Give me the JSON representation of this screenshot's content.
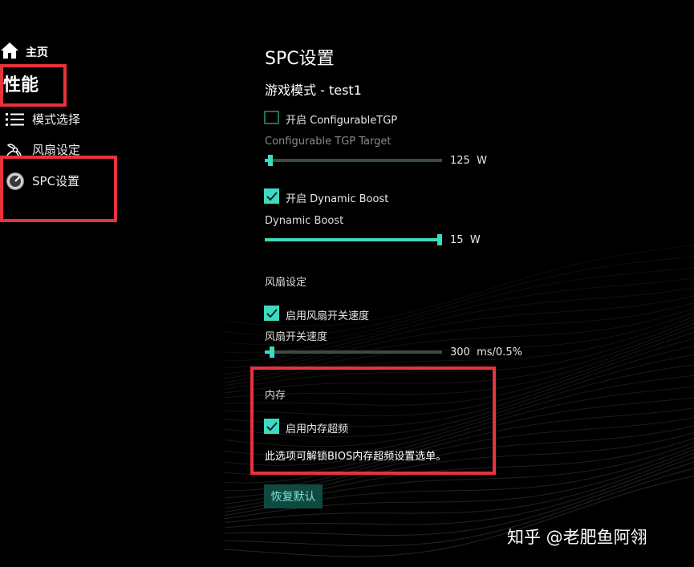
{
  "sidebar": {
    "home_label": "主页",
    "section_title": "性能",
    "items": [
      {
        "label": "模式选择",
        "icon": "list-icon"
      },
      {
        "label": "风扇设定",
        "icon": "fan-icon"
      },
      {
        "label": "SPC设置",
        "icon": "gauge-icon"
      }
    ]
  },
  "main": {
    "title": "SPC设置",
    "subtitle": "游戏模式 - test1",
    "configurable_tgp_checkbox": {
      "label": "开启 ConfigurableTGP",
      "checked": false
    },
    "configurable_tgp_target": {
      "label": "Configurable TGP Target",
      "value": "125",
      "unit": "W",
      "fraction": 0.02
    },
    "dynamic_boost_checkbox": {
      "label": "开启 Dynamic Boost",
      "checked": true
    },
    "dynamic_boost": {
      "label": "Dynamic Boost",
      "value": "15",
      "unit": "W",
      "fraction": 1.0
    },
    "fan_section": {
      "title": "风扇设定"
    },
    "fan_switch_checkbox": {
      "label": "启用风扇开关速度",
      "checked": true
    },
    "fan_switch_speed": {
      "label": "风扇开关速度",
      "value": "300",
      "unit": "ms/0.5%",
      "fraction": 0.03
    },
    "memory_section": {
      "title": "内存"
    },
    "memory_oc_checkbox": {
      "label": "启用内存超频",
      "checked": true
    },
    "memory_description": "此选项可解锁BIOS内存超频设置选单。",
    "reset_button": "恢复默认"
  },
  "watermark": "知乎 @老肥鱼阿翎",
  "colors": {
    "accent": "#3fd9c1",
    "highlight_box": "#e8323c",
    "background": "#000000"
  }
}
